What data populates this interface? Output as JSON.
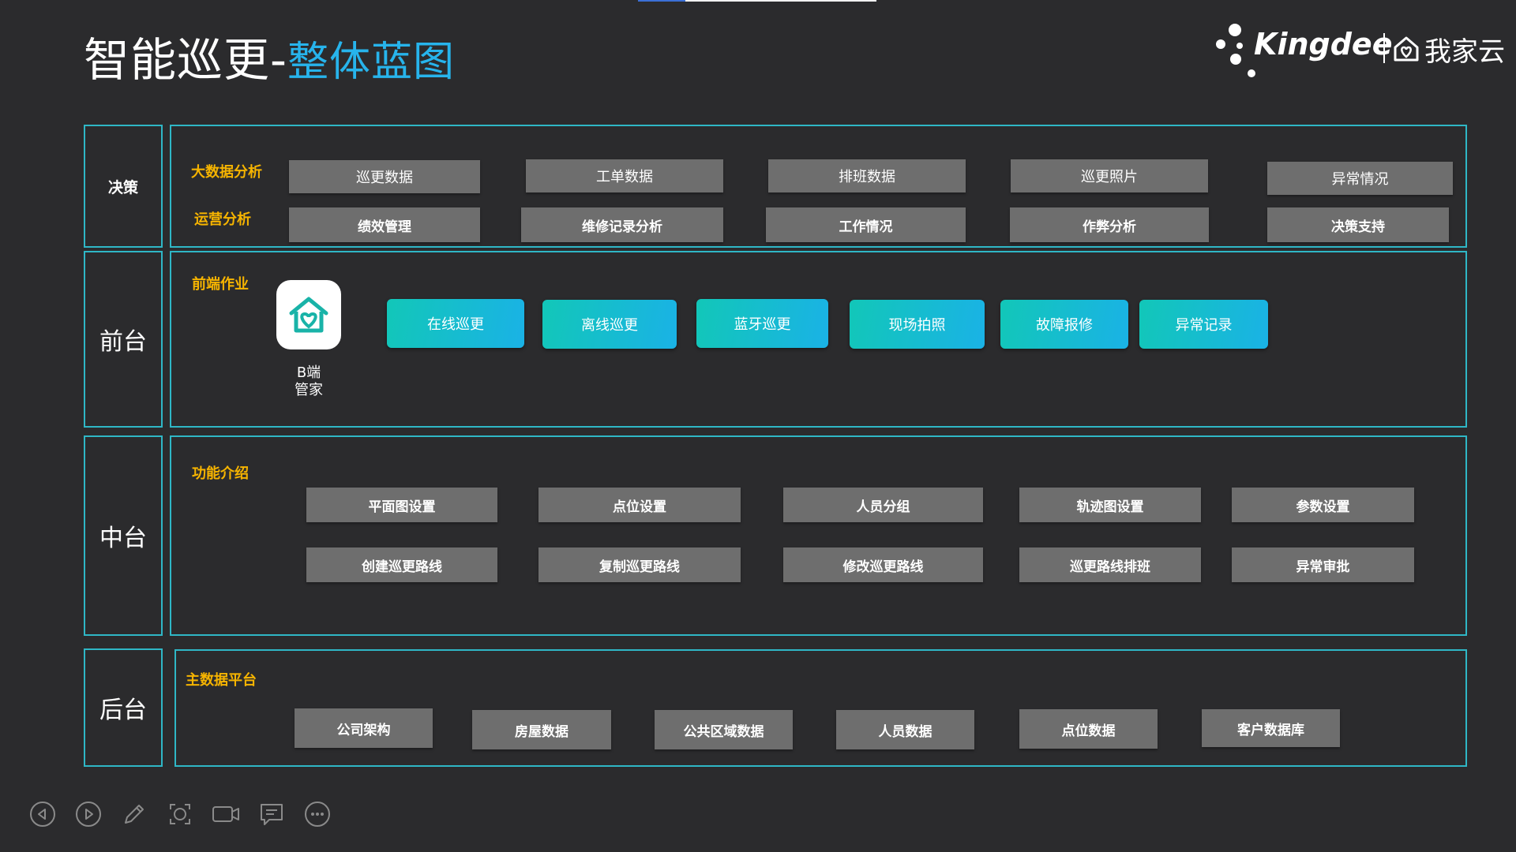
{
  "header": {
    "title_main": "智能巡更-",
    "title_sub": "整体蓝图"
  },
  "logo": {
    "brand": "Kingdee",
    "product": "我家云"
  },
  "rows": {
    "decision": {
      "label": "决策",
      "big_data_title": "大数据分析",
      "ops_title": "运营分析",
      "big_data_items": [
        "巡更数据",
        "工单数据",
        "排班数据",
        "巡更照片",
        "异常情况"
      ],
      "ops_items": [
        "绩效管理",
        "维修记录分析",
        "工作情况",
        "作弊分析",
        "决策支持"
      ]
    },
    "front": {
      "label": "前台",
      "section_title": "前端作业",
      "app_label_line1": "B端",
      "app_label_line2": "管家",
      "items": [
        "在线巡更",
        "离线巡更",
        "蓝牙巡更",
        "现场拍照",
        "故障报修",
        "异常记录"
      ]
    },
    "middle": {
      "label": "中台",
      "section_title": "功能介绍",
      "row1": [
        "平面图设置",
        "点位设置",
        "人员分组",
        "轨迹图设置",
        "参数设置"
      ],
      "row2": [
        "创建巡更路线",
        "复制巡更路线",
        "修改巡更路线",
        "巡更路线排班",
        "异常审批"
      ]
    },
    "back": {
      "label": "后台",
      "section_title": "主数据平台",
      "items": [
        "公司架构",
        "房屋数据",
        "公共区域数据",
        "人员数据",
        "点位数据",
        "客户数据库"
      ]
    }
  },
  "controls": [
    "prev-icon",
    "next-icon",
    "pen-icon",
    "zoom-icon",
    "camera-icon",
    "subtitle-icon",
    "more-icon"
  ]
}
